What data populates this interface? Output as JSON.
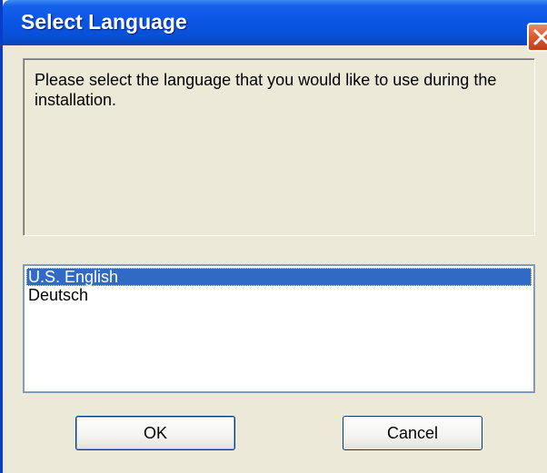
{
  "window": {
    "title": "Select Language"
  },
  "message": {
    "text": "Please select the language that you would like to use during the installation."
  },
  "languages": {
    "items": [
      {
        "label": "U.S. English",
        "selected": true
      },
      {
        "label": "Deutsch",
        "selected": false
      }
    ]
  },
  "buttons": {
    "ok_label": "OK",
    "cancel_label": "Cancel"
  },
  "icons": {
    "close": "close-icon"
  },
  "colors": {
    "titlebar": "#0a56e4",
    "face": "#ece9d8",
    "selection": "#316ac5",
    "close": "#d85a2e"
  }
}
